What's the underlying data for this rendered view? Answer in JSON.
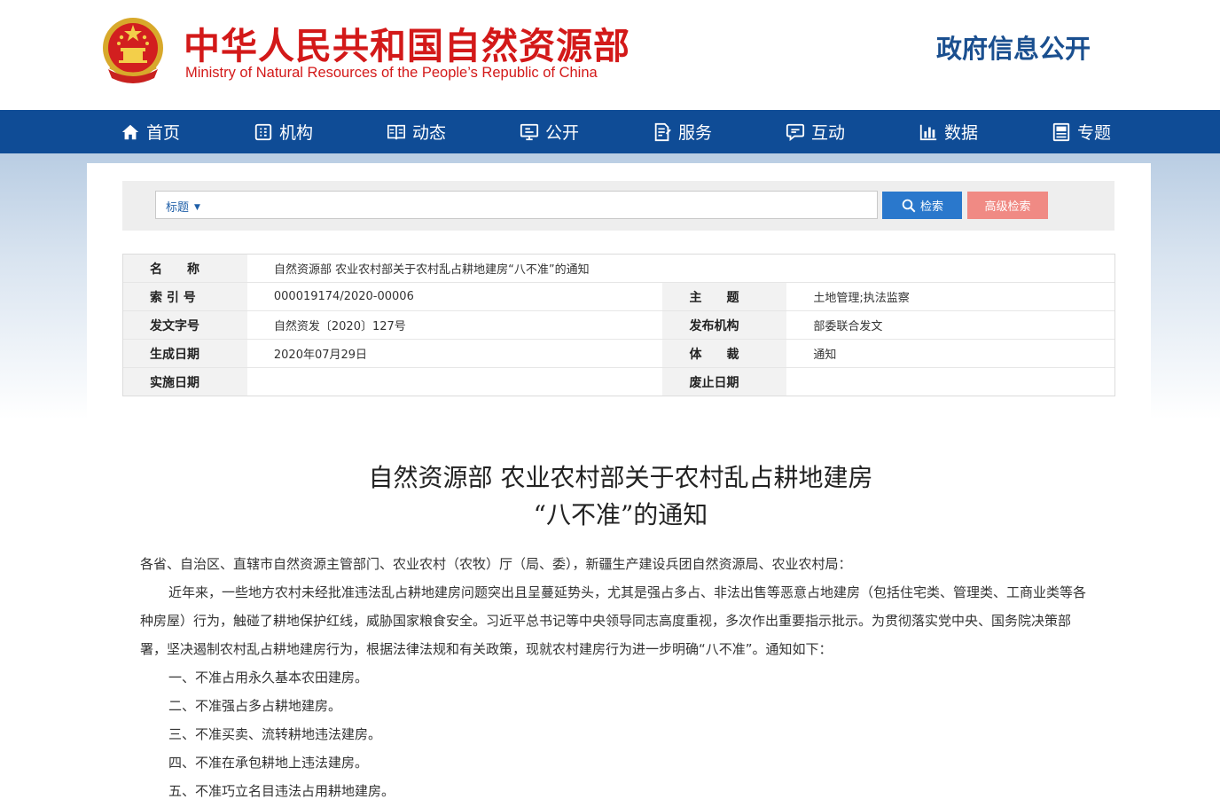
{
  "header": {
    "title_cn": "中华人民共和国自然资源部",
    "title_en": "Ministry of Natural Resources of the People’s Republic of China",
    "section": "政府信息公开"
  },
  "colors": {
    "brand_red": "#d31919",
    "nav_blue": "#0f4c96",
    "search_blue": "#2a78cc",
    "adv_pink": "#f08a84"
  },
  "nav": [
    {
      "label": "首页",
      "icon": "home-icon"
    },
    {
      "label": "机构",
      "icon": "org-icon"
    },
    {
      "label": "动态",
      "icon": "book-icon"
    },
    {
      "label": "公开",
      "icon": "monitor-icon"
    },
    {
      "label": "服务",
      "icon": "edit-doc-icon"
    },
    {
      "label": "互动",
      "icon": "chat-icon"
    },
    {
      "label": "数据",
      "icon": "bar-chart-icon"
    },
    {
      "label": "专题",
      "icon": "topic-icon"
    }
  ],
  "search": {
    "type": "标题",
    "value": "",
    "button": "检索",
    "advanced": "高级检索"
  },
  "info": {
    "name_label": "名　　称",
    "name": "自然资源部 农业农村部关于农村乱占耕地建房“八不准”的通知",
    "index_label": "索 引 号",
    "index": "000019174/2020-00006",
    "subject_label": "主　　题",
    "subject": "土地管理;执法监察",
    "docno_label": "发文字号",
    "docno": "自然资发〔2020〕127号",
    "publisher_label": "发布机构",
    "publisher": "部委联合发文",
    "created_label": "生成日期",
    "created": "2020年07月29日",
    "genre_label": "体　　裁",
    "genre": "通知",
    "effective_label": "实施日期",
    "effective": "",
    "repeal_label": "废止日期",
    "repeal": ""
  },
  "doc": {
    "title_line1": "自然资源部 农业农村部关于农村乱占耕地建房",
    "title_line2": "“八不准”的通知",
    "salutation": "各省、自治区、直辖市自然资源主管部门、农业农村（农牧）厅（局、委），新疆生产建设兵团自然资源局、农业农村局：",
    "intro": "近年来，一些地方农村未经批准违法乱占耕地建房问题突出且呈蔓延势头，尤其是强占多占、非法出售等恶意占地建房（包括住宅类、管理类、工商业类等各种房屋）行为，触碰了耕地保护红线，威胁国家粮食安全。习近平总书记等中央领导同志高度重视，多次作出重要指示批示。为贯彻落实党中央、国务院决策部署，坚决遏制农村乱占耕地建房行为，根据法律法规和有关政策，现就农村建房行为进一步明确“八不准”。通知如下：",
    "items": [
      "一、不准占用永久基本农田建房。",
      "二、不准强占多占耕地建房。",
      "三、不准买卖、流转耕地违法建房。",
      "四、不准在承包耕地上违法建房。",
      "五、不准巧立名目违法占用耕地建房。"
    ]
  }
}
